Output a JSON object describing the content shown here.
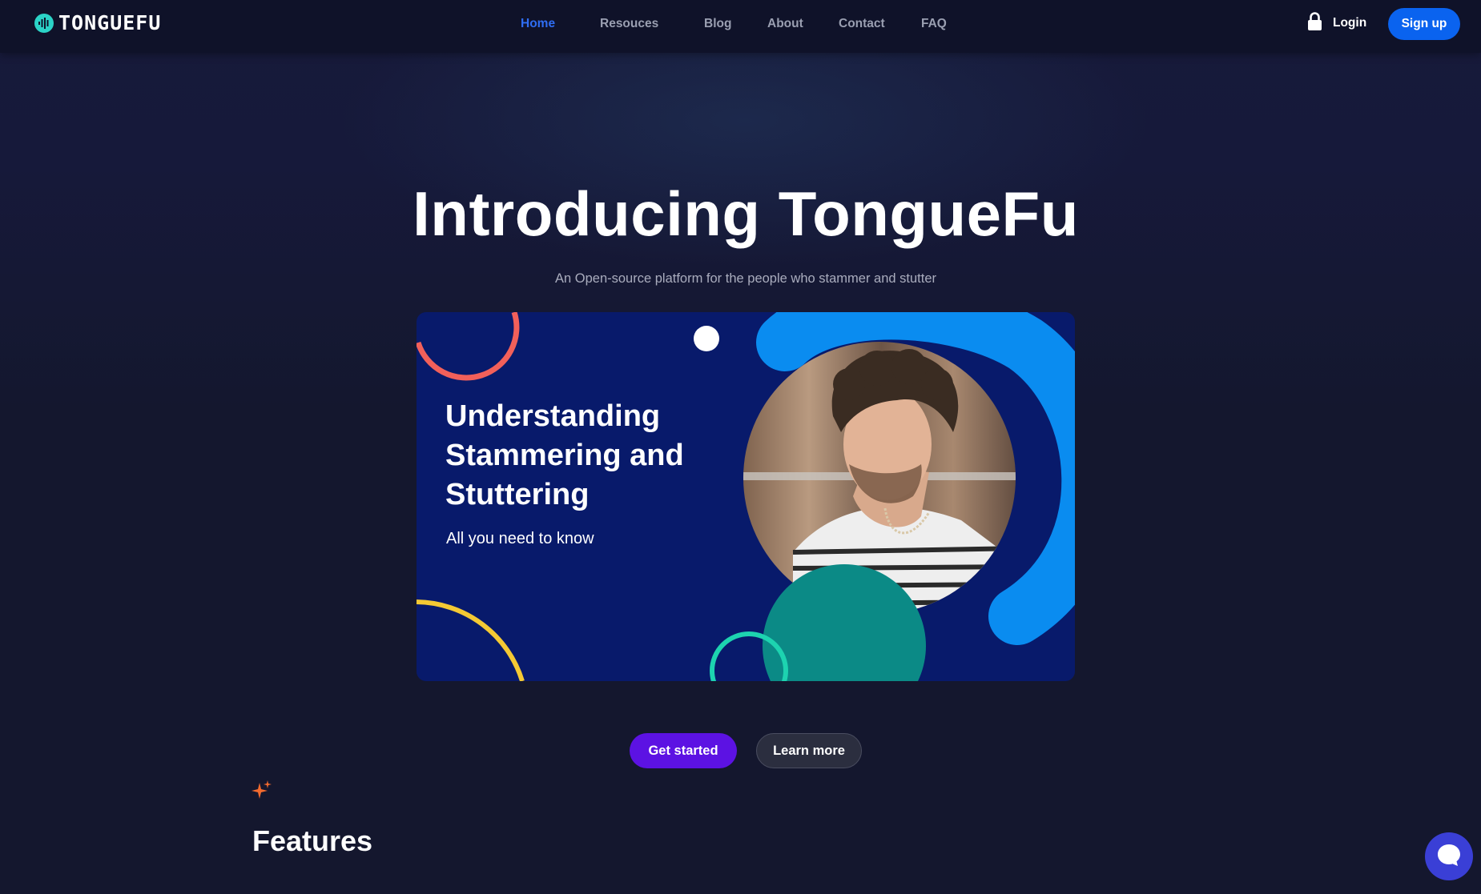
{
  "brand": {
    "name": "TONGUEFU",
    "accent": "#2bd3c7"
  },
  "nav": {
    "items": [
      {
        "label": "Home",
        "active": true
      },
      {
        "label": "Resouces",
        "active": false
      },
      {
        "label": "Blog",
        "active": false
      },
      {
        "label": "About",
        "active": false
      },
      {
        "label": "Contact",
        "active": false
      },
      {
        "label": "FAQ",
        "active": false
      }
    ],
    "active_color": "#2f6df2",
    "login_label": "Login",
    "login_icon": "lock-icon",
    "signup_label": "Sign up",
    "signup_color": "#0a63ef"
  },
  "hero": {
    "title": "Introducing TongueFu",
    "subtitle": "An Open-source platform for the people who stammer and stutter"
  },
  "banner": {
    "heading": "Understanding Stammering and Stuttering",
    "subheading": "All you need to know",
    "background": "#081a6b",
    "colors": {
      "coral": "#f2605a",
      "blue": "#0a8cf0",
      "teal": "#0b8a86",
      "yellow": "#f4c934",
      "green": "#1dd3b0"
    }
  },
  "cta": {
    "primary_label": "Get started",
    "primary_color": "#5c12e3",
    "secondary_label": "Learn more"
  },
  "features": {
    "icon": "sparkle-icon",
    "title": "Features"
  },
  "chat": {
    "icon": "chat-bubble-icon",
    "color": "#3a3fd6"
  }
}
